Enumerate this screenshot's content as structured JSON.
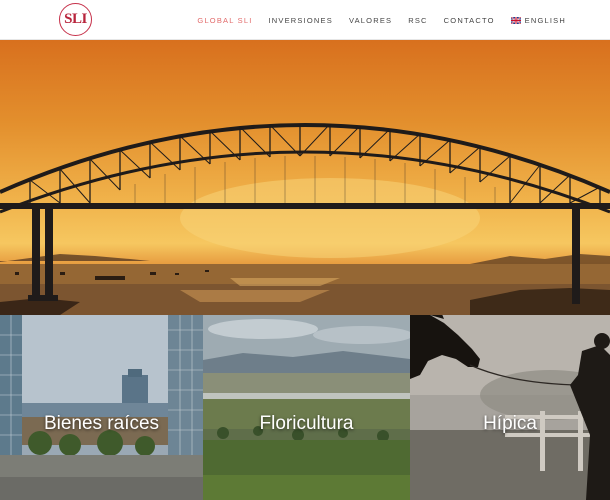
{
  "logo_text": "SLI",
  "nav": {
    "items": [
      {
        "label": "GLOBAL SLI",
        "active": true
      },
      {
        "label": "INVERSIONES",
        "active": false
      },
      {
        "label": "VALORES",
        "active": false
      },
      {
        "label": "RSC",
        "active": false
      },
      {
        "label": "CONTACTO",
        "active": false
      }
    ],
    "language": {
      "label": "ENGLISH",
      "icon": "uk-flag-icon"
    }
  },
  "tiles": [
    {
      "label": "Bienes raíces"
    },
    {
      "label": "Floricultura"
    },
    {
      "label": "Hípica"
    }
  ],
  "colors": {
    "accent": "#e26a6a",
    "logo": "#b8243c"
  }
}
